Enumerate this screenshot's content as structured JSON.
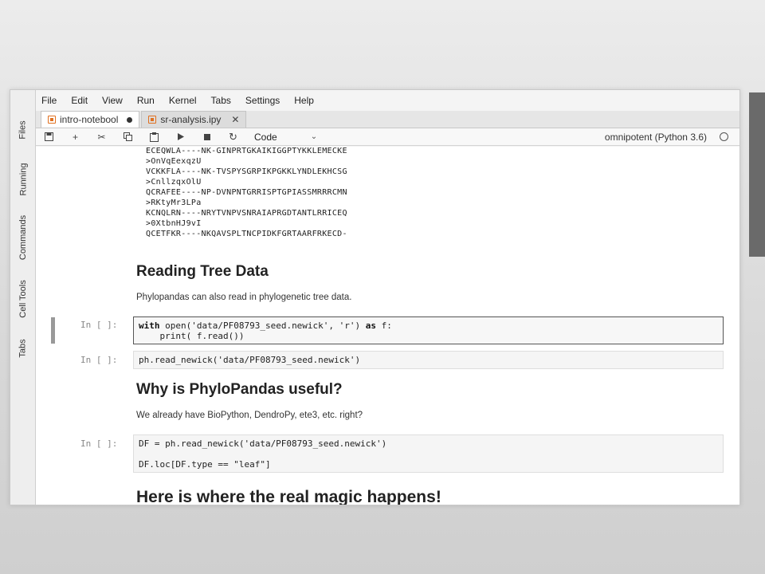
{
  "menu": [
    "File",
    "Edit",
    "View",
    "Run",
    "Kernel",
    "Tabs",
    "Settings",
    "Help"
  ],
  "sidebar": [
    "Files",
    "Running",
    "Commands",
    "Cell Tools",
    "Tabs"
  ],
  "tabs": [
    {
      "label": "intro-notebool",
      "active": true,
      "modified": true
    },
    {
      "label": "sr-analysis.ipy",
      "active": false
    }
  ],
  "toolbar": {
    "cell_type": "Code",
    "kernel": "omnipotent (Python 3.6)"
  },
  "output_lines": [
    "ECEQWLA----NK-GINPRTGKAIKIGGPTYKKLEMECKE",
    ">OnVqEexqzU",
    "VCKKFLA----NK-TVSPYSGRPIKPGKKLYNDLEKHCSG",
    ">CnllzqxOlU",
    "QCRAFEE----NP-DVNPNTGRRISPTGPIASSMRRRCMN",
    ">RKtyMr3LPa",
    "KCNQLRN----NRYTVNPVSNRAIAPRGDTANTLRRICEQ",
    ">0XtbnHJ9vI",
    "QCETFKR----NKQAVSPLTNCPIDKFGRTAARFRKECD-"
  ],
  "section1": {
    "heading": "Reading Tree Data",
    "text": "Phylopandas can also read in phylogenetic tree data."
  },
  "cell1": {
    "prompt": "In [ ]:",
    "line1_kw": "with",
    "line1_rest": " open('data/PF08793_seed.newick', 'r') ",
    "line1_kw2": "as",
    "line1_end": " f:",
    "line2": "    print( f.read())"
  },
  "cell2": {
    "prompt": "In [ ]:",
    "line1": "ph.read_newick('data/PF08793_seed.newick')"
  },
  "section2": {
    "heading": "Why is PhyloPandas useful?",
    "text": "We already have BioPython, DendroPy, ete3, etc. right?"
  },
  "cell3": {
    "prompt": "In [ ]:",
    "line1": "DF = ph.read_newick('data/PF08793_seed.newick')",
    "line2": "",
    "line3": "DF.loc[DF.type == \"leaf\"]"
  },
  "section3": {
    "heading": "Here is where the real magic happens!"
  }
}
